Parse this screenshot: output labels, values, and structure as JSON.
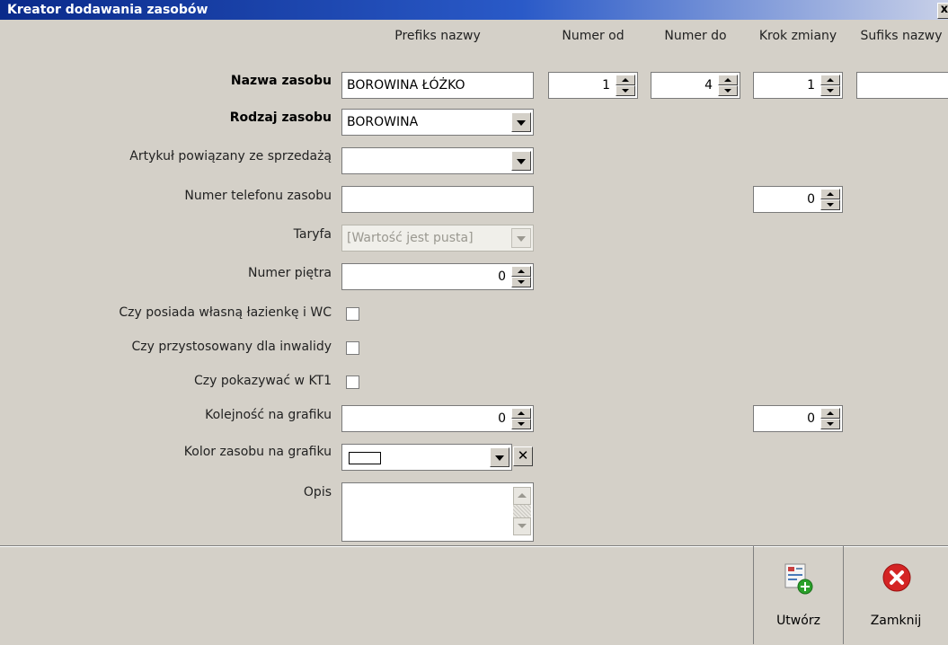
{
  "window": {
    "title": "Kreator dodawania zasobów",
    "close_glyph": "x"
  },
  "columns": {
    "prefix": "Prefiks nazwy",
    "number_from": "Numer od",
    "number_to": "Numer do",
    "step": "Krok zmiany",
    "suffix": "Sufiks nazwy"
  },
  "form": {
    "name": {
      "label": "Nazwa zasobu",
      "prefix_value": "BOROWINA ŁÓŻKO",
      "number_from": "1",
      "number_to": "4",
      "step": "1",
      "suffix_value": ""
    },
    "type": {
      "label": "Rodzaj zasobu",
      "value": "BOROWINA"
    },
    "article": {
      "label": "Artykuł powiązany ze sprzedażą",
      "value": ""
    },
    "phone": {
      "label": "Numer telefonu zasobu",
      "value": "",
      "step": "0"
    },
    "tariff": {
      "label": "Taryfa",
      "placeholder": "[Wartość jest pusta]"
    },
    "floor": {
      "label": "Numer piętra",
      "value": "0"
    },
    "bathroom": {
      "label": "Czy posiada własną łazienkę i WC",
      "checked": false
    },
    "disabled_access": {
      "label": "Czy przystosowany dla inwalidy",
      "checked": false
    },
    "show_kt1": {
      "label": "Czy pokazywać w KT1",
      "checked": false
    },
    "order": {
      "label": "Kolejność na grafiku",
      "value": "0",
      "step": "0"
    },
    "color": {
      "label": "Kolor zasobu na grafiku",
      "swatch": "#ffffff"
    },
    "description": {
      "label": "Opis",
      "value": ""
    }
  },
  "footer": {
    "create_label": "Utwórz",
    "close_label": "Zamknij"
  },
  "icons": {
    "create": "create-resource-icon",
    "close": "close-red-icon"
  }
}
